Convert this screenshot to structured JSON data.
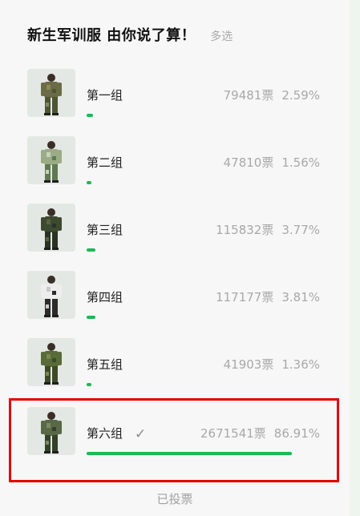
{
  "poll": {
    "title": "新生军训服 由你说了算！",
    "type_label": "多选",
    "options": [
      {
        "label": "第一组",
        "votes": "79481票",
        "percent": "2.59%",
        "fraction": 0.0259,
        "selected": false,
        "uniform": "woodland-camo"
      },
      {
        "label": "第二组",
        "votes": "47810票",
        "percent": "1.56%",
        "fraction": 0.0156,
        "selected": false,
        "uniform": "light-digital-camo"
      },
      {
        "label": "第三组",
        "votes": "115832票",
        "percent": "3.77%",
        "fraction": 0.0377,
        "selected": false,
        "uniform": "dark-green-jacket"
      },
      {
        "label": "第四组",
        "votes": "117177票",
        "percent": "3.81%",
        "fraction": 0.0381,
        "selected": false,
        "uniform": "white-black-jacket"
      },
      {
        "label": "第五组",
        "votes": "41903票",
        "percent": "1.36%",
        "fraction": 0.0136,
        "selected": false,
        "uniform": "jungle-camo"
      },
      {
        "label": "第六组",
        "votes": "2671541票",
        "percent": "86.91%",
        "fraction": 0.8691,
        "selected": true,
        "uniform": "camo-vest"
      }
    ],
    "voted_label": "已投票",
    "checkmark_icon": "check-icon"
  },
  "colors": {
    "bar": "#1fb656",
    "highlight_box": "#e30000"
  }
}
